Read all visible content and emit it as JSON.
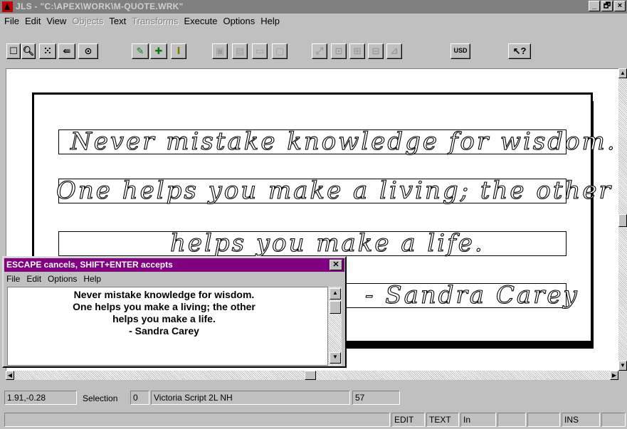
{
  "window": {
    "title": "JLS - \"C:\\APEX\\WORK\\M-QUOTE.WRK\"",
    "buttons": [
      "_",
      "🗗",
      "×"
    ]
  },
  "menubar": [
    {
      "label": "File",
      "enabled": true
    },
    {
      "label": "Edit",
      "enabled": true
    },
    {
      "label": "View",
      "enabled": true
    },
    {
      "label": "Objects",
      "enabled": false
    },
    {
      "label": "Text",
      "enabled": true
    },
    {
      "label": "Transforms",
      "enabled": false
    },
    {
      "label": "Execute",
      "enabled": true
    },
    {
      "label": "Options",
      "enabled": true
    },
    {
      "label": "Help",
      "enabled": true
    }
  ],
  "toolbar": {
    "usd_label": "USD",
    "help_glyph": "↖?",
    "icons": [
      "select-box-icon",
      "zoom-icon",
      "grid-icon",
      "pan-icon",
      "view-icon",
      "pen-icon",
      "add-icon",
      "text-cursor-icon",
      "frame-icon",
      "layout-icon",
      "field-icon",
      "object-icon",
      "scale-icon",
      "resize-icon",
      "align-icon",
      "distribute-icon",
      "transform-icon",
      "usd-button",
      "context-help-icon"
    ]
  },
  "document": {
    "lines": [
      "Never mistake knowledge for wisdom.",
      "One helps you make a living; the other",
      "helps you make a life.",
      "- Sandra Carey"
    ]
  },
  "status": {
    "coords": "1.91,-0.28",
    "selection_label": "Selection",
    "selection_value": "0",
    "font_name": "Victoria Script 2L NH",
    "size_value": "57",
    "edit": "EDIT",
    "text": "TEXT",
    "units": "In",
    "ins": "INS"
  },
  "dialog": {
    "title": "ESCAPE cancels, SHIFT+ENTER accepts",
    "menu": [
      "File",
      "Edit",
      "Options",
      "Help"
    ],
    "text_lines": [
      "Never mistake knowledge for wisdom.",
      "One helps you make a living; the other",
      "helps you make a life.",
      "- Sandra Carey"
    ]
  }
}
